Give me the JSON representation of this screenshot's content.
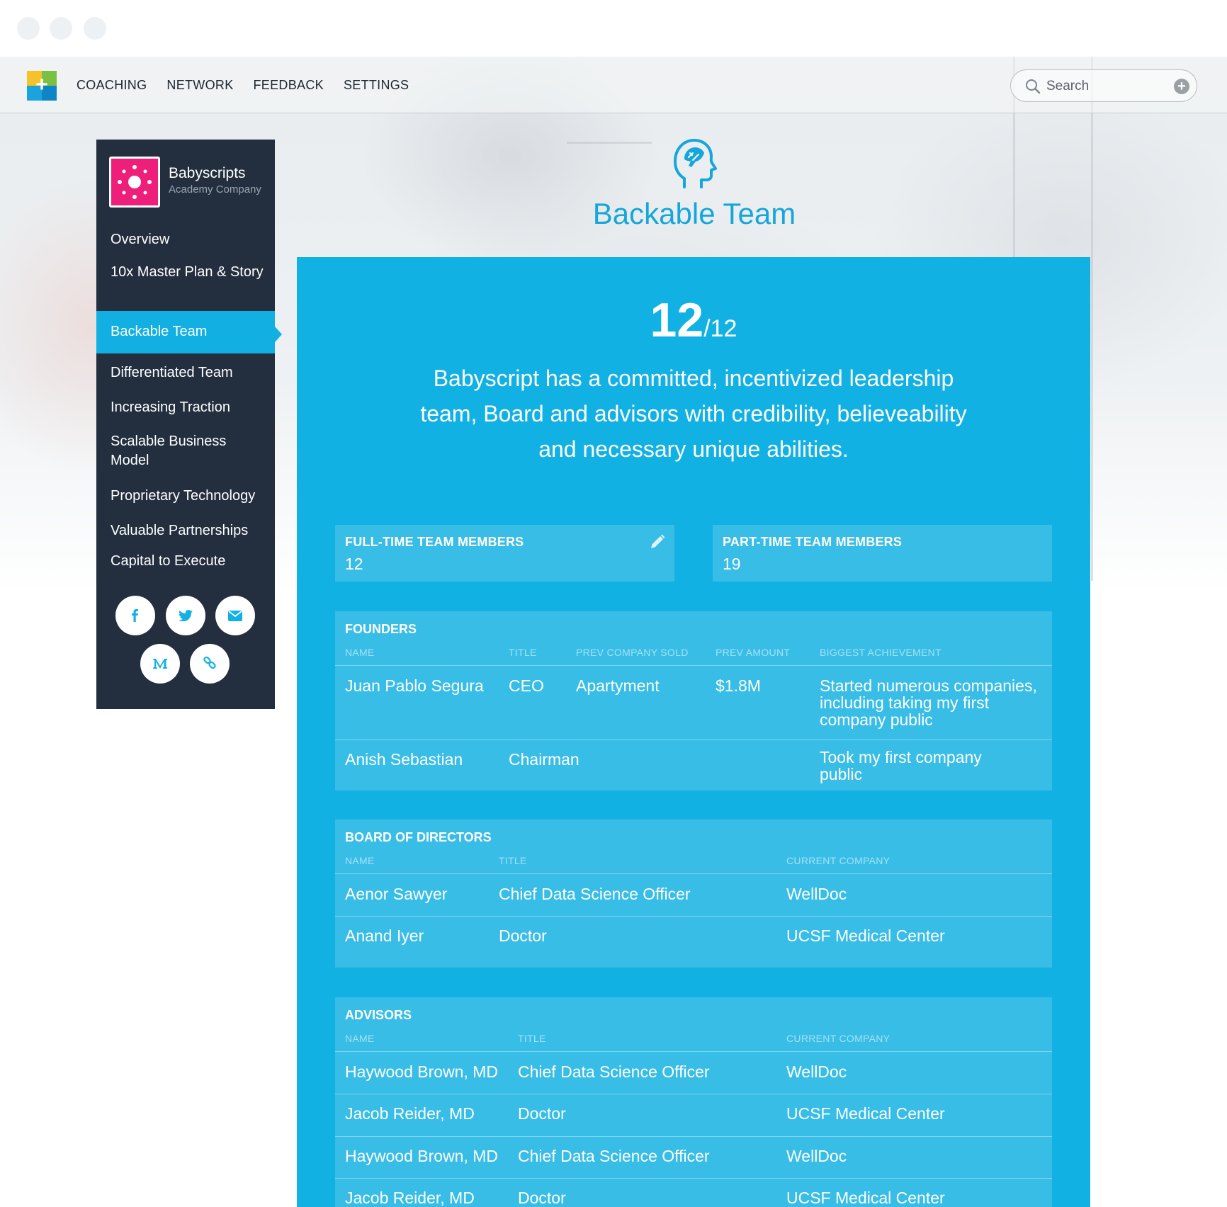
{
  "nav": {
    "links": [
      "COACHING",
      "NETWORK",
      "FEEDBACK",
      "SETTINGS"
    ],
    "search_placeholder": "Search"
  },
  "sidebar": {
    "company_name": "Babyscripts",
    "company_subtitle": "Academy Company",
    "items": [
      {
        "label": "Overview"
      },
      {
        "label": "10x Master Plan & Story"
      },
      {
        "label": "Backable Team",
        "active": true
      },
      {
        "label": "Differentiated Team"
      },
      {
        "label": "Increasing Traction"
      },
      {
        "label": "Scalable Business Model"
      },
      {
        "label": "Proprietary Technology"
      },
      {
        "label": "Valuable Partnerships"
      },
      {
        "label": "Capital to Execute"
      }
    ],
    "social": [
      "facebook-icon",
      "twitter-icon",
      "email-icon",
      "medium-icon",
      "link-icon"
    ]
  },
  "page": {
    "title": "Backable Team",
    "icon": "head-brain-icon",
    "score": "12",
    "score_total": "/12",
    "summary": "Babyscript has a committed, incentivized leadership team, Board and advisors with credibility, believeability and necessary unique abilities."
  },
  "stats": {
    "fulltime_label": "FULL-TIME TEAM MEMBERS",
    "fulltime_value": "12",
    "parttime_label": "PART-TIME TEAM MEMBERS",
    "parttime_value": "19"
  },
  "founders": {
    "title": "FOUNDERS",
    "headers": [
      "NAME",
      "TITLE",
      "PREV COMPANY SOLD",
      "PREV AMOUNT",
      "BIGGEST ACHIEVEMENT"
    ],
    "rows": [
      [
        "Juan Pablo Segura",
        "CEO",
        "Apartyment",
        "$1.8M",
        "Started numerous companies, including taking my first company public"
      ],
      [
        "Anish Sebastian",
        "Chairman",
        "",
        "",
        "Took my first company public"
      ]
    ]
  },
  "board": {
    "title": "BOARD OF DIRECTORS",
    "headers": [
      "NAME",
      "TITLE",
      "CURRENT COMPANY"
    ],
    "rows": [
      [
        "Aenor Sawyer",
        "Chief Data Science Officer",
        "WellDoc"
      ],
      [
        "Anand Iyer",
        "Doctor",
        "UCSF Medical Center"
      ]
    ]
  },
  "advisors": {
    "title": "ADVISORS",
    "headers": [
      "NAME",
      "TITLE",
      "CURRENT COMPANY"
    ],
    "rows": [
      [
        "Haywood Brown, MD",
        "Chief Data Science Officer",
        "WellDoc"
      ],
      [
        "Jacob Reider, MD",
        "Doctor",
        "UCSF Medical Center"
      ],
      [
        "Haywood Brown, MD",
        "Chief Data Science Officer",
        "WellDoc"
      ],
      [
        "Jacob Reider, MD",
        "Doctor",
        "UCSF Medical Center"
      ]
    ]
  },
  "colors": {
    "accent": "#12b1e3",
    "sidebar_bg": "#232f3e",
    "company_logo": "#ee1f7a"
  }
}
